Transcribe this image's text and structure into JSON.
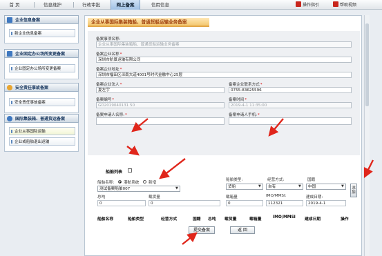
{
  "topnav": {
    "items": [
      "首 页",
      "信息维护",
      "行政审批",
      "网上备案",
      "信用信息"
    ],
    "tools": [
      "操作指引",
      "帮助视频"
    ]
  },
  "sidebar": {
    "sections": [
      {
        "title": "企业信息备案",
        "items": [
          "新企业信息备案"
        ]
      },
      {
        "title": "企业固定办公场所变更备案",
        "items": [
          "企业固定办公场所变更备案"
        ]
      },
      {
        "title": "安全责任事故备案",
        "items": [
          "安全责任事故备案"
        ]
      },
      {
        "title": "国际集装箱、普通货运备案",
        "items": [
          "企业从事国际运输",
          "企业或船舶退出运输"
        ]
      }
    ]
  },
  "main": {
    "title": "企业从事国际集装箱船、普通货船运输业务备案",
    "fields": {
      "item_name_label": "备案事项名称:",
      "item_name_value": "企业从事国际集装箱船、普通货船运输业务备案",
      "company_name_label": "备案企业名称",
      "company_name_value": "深圳市航景运输有限公司",
      "company_addr_label": "备案企业地址",
      "company_addr_value": "深圳市福田区深南大道4001号时代金融中心25层",
      "legal_rep_label": "备案企业法人",
      "legal_rep_value": "夏左宇",
      "contact_label": "备案企业联系方式",
      "contact_value": "0755-83625596",
      "record_no_label": "备案编号",
      "record_no_value": "GD2019040131 50",
      "record_time_label": "备案时间",
      "record_time_value": "2019-4-1 11:35:00",
      "applicant_name_label": "备案申请人名称:",
      "applicant_name_value": "",
      "applicant_phone_label": "备案申请人手机:",
      "applicant_phone_value": ""
    },
    "ship": {
      "list_title": "船舶列表",
      "name_label": "船舶名称:",
      "radio_existing": "港航系统",
      "radio_new": "新增",
      "name_value": "测试备案船舶007",
      "type_label": "船舶类型:",
      "type_value": "货船",
      "mode_label": "经营方式:",
      "mode_value": "自有",
      "country_label": "国籍",
      "country_value": "中国",
      "add_label": "添加",
      "tonnage_label": "总吨",
      "tonnage_value": "0",
      "load_label": "载货量",
      "load_value": "0",
      "box_label": "载箱量",
      "box_value": "0",
      "imo_label": "IMO/MMSI:",
      "imo_value": "112321",
      "build_date_label": "建成日期:",
      "build_date_value": "2019-4-1",
      "columns": [
        "船舶名称",
        "船舶类型",
        "经营方式",
        "国籍",
        "总吨",
        "载货量",
        "载箱量",
        "IMO/MMSI",
        "建成日期",
        "操作"
      ]
    },
    "buttons": {
      "submit": "提交备案",
      "back": "返 回"
    }
  },
  "colors": {
    "accent_title": "#f4c870",
    "required": "#d40000",
    "annotation_arrow": "#e0261b"
  }
}
